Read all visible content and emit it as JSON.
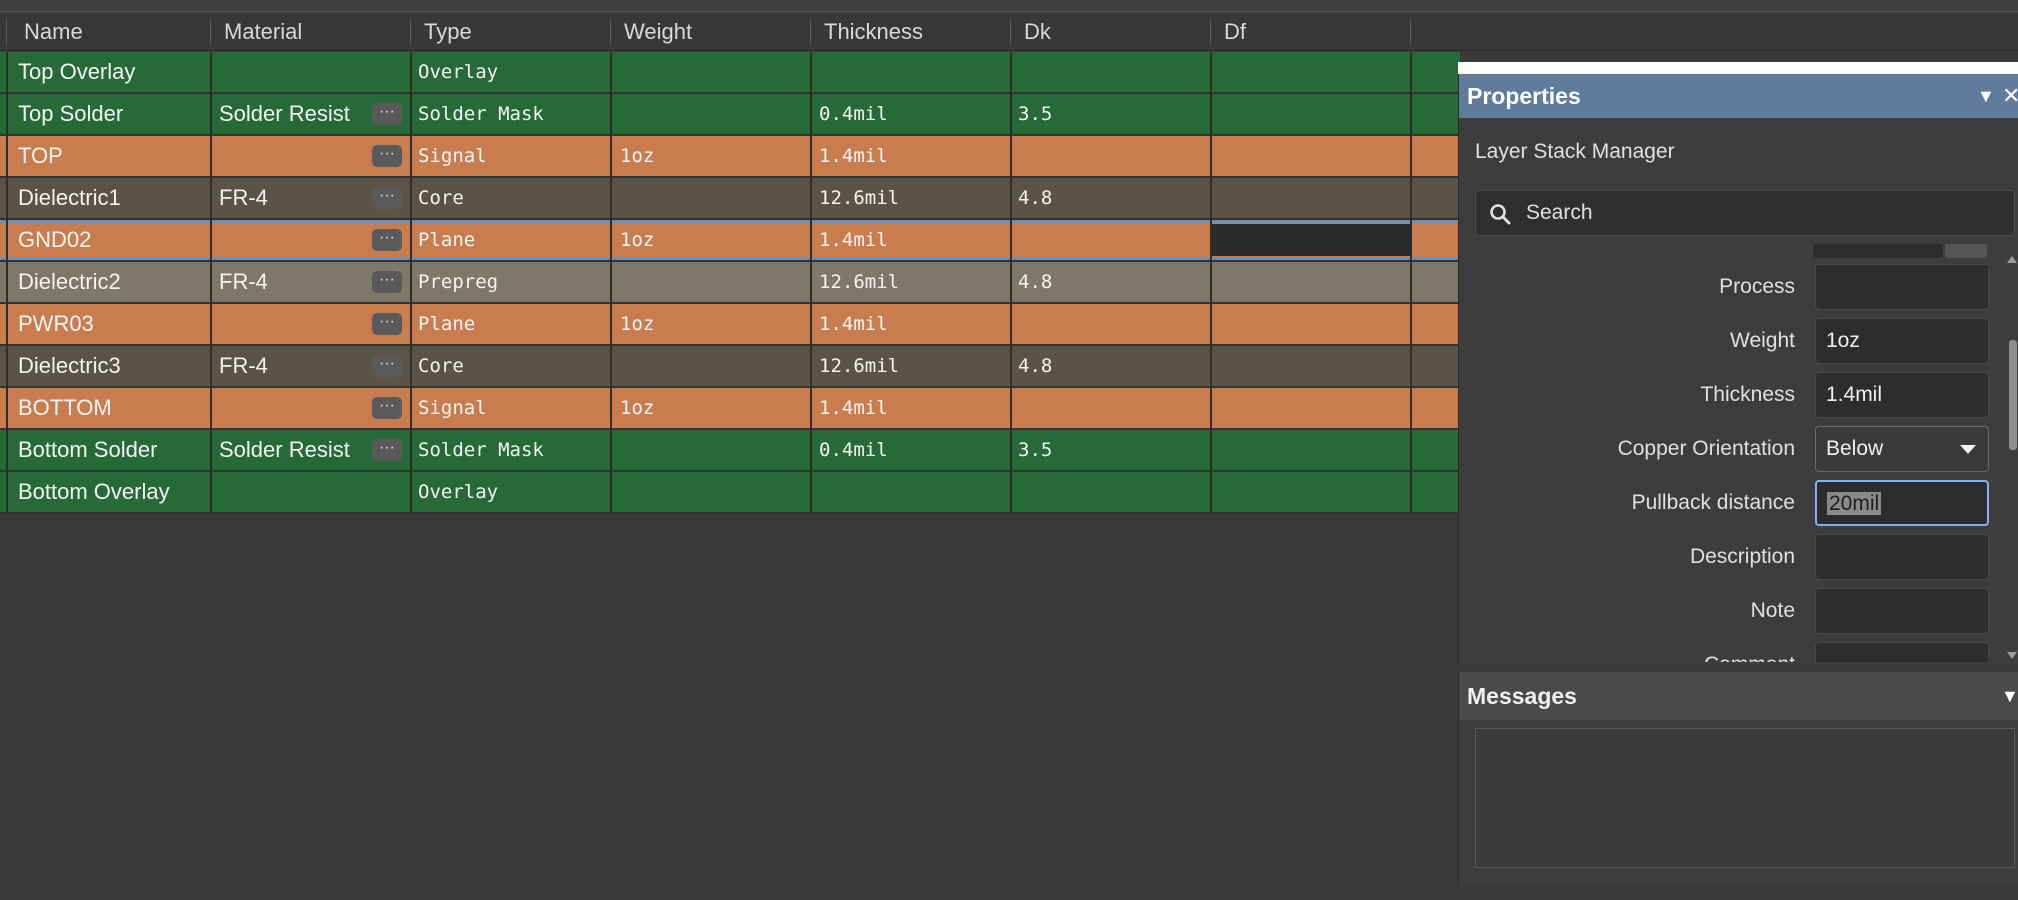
{
  "columns": [
    "Name",
    "Material",
    "Type",
    "Weight",
    "Thickness",
    "Dk",
    "Df"
  ],
  "layers": [
    {
      "name": "Top Overlay",
      "material": "",
      "type": "Overlay",
      "weight": "",
      "thickness": "",
      "dk": "",
      "df": "",
      "style": "overlay",
      "has_material_button": false
    },
    {
      "name": "Top Solder",
      "material": "Solder Resist",
      "type": "Solder Mask",
      "weight": "",
      "thickness": "0.4mil",
      "dk": "3.5",
      "df": "",
      "style": "solder",
      "has_material_button": true
    },
    {
      "name": "TOP",
      "material": "",
      "type": "Signal",
      "weight": "1oz",
      "thickness": "1.4mil",
      "dk": "",
      "df": "",
      "style": "signal",
      "has_material_button": true
    },
    {
      "name": "Dielectric1",
      "material": "FR-4",
      "type": "Core",
      "weight": "",
      "thickness": "12.6mil",
      "dk": "4.8",
      "df": "",
      "style": "core",
      "has_material_button": true
    },
    {
      "name": "GND02",
      "material": "",
      "type": "Plane",
      "weight": "1oz",
      "thickness": "1.4mil",
      "dk": "",
      "df": "",
      "style": "signal",
      "has_material_button": true,
      "selected": true
    },
    {
      "name": "Dielectric2",
      "material": "FR-4",
      "type": "Prepreg",
      "weight": "",
      "thickness": "12.6mil",
      "dk": "4.8",
      "df": "",
      "style": "prepreg",
      "has_material_button": true
    },
    {
      "name": "PWR03",
      "material": "",
      "type": "Plane",
      "weight": "1oz",
      "thickness": "1.4mil",
      "dk": "",
      "df": "",
      "style": "signal",
      "has_material_button": true
    },
    {
      "name": "Dielectric3",
      "material": "FR-4",
      "type": "Core",
      "weight": "",
      "thickness": "12.6mil",
      "dk": "4.8",
      "df": "",
      "style": "core",
      "has_material_button": true
    },
    {
      "name": "BOTTOM",
      "material": "",
      "type": "Signal",
      "weight": "1oz",
      "thickness": "1.4mil",
      "dk": "",
      "df": "",
      "style": "signal",
      "has_material_button": true
    },
    {
      "name": "Bottom Solder",
      "material": "Solder Resist",
      "type": "Solder Mask",
      "weight": "",
      "thickness": "0.4mil",
      "dk": "3.5",
      "df": "",
      "style": "solder",
      "has_material_button": true
    },
    {
      "name": "Bottom Overlay",
      "material": "",
      "type": "Overlay",
      "weight": "",
      "thickness": "",
      "dk": "",
      "df": "",
      "style": "overlay",
      "has_material_button": false
    }
  ],
  "material_button_label": "···",
  "properties": {
    "title": "Properties",
    "subtitle": "Layer Stack Manager",
    "search_placeholder": "Search",
    "fields": [
      {
        "label": "Process",
        "value": "",
        "kind": "text"
      },
      {
        "label": "Weight",
        "value": "1oz",
        "kind": "text"
      },
      {
        "label": "Thickness",
        "value": "1.4mil",
        "kind": "text"
      },
      {
        "label": "Copper Orientation",
        "value": "Below",
        "kind": "dropdown"
      },
      {
        "label": "Pullback distance",
        "value": "20mil",
        "kind": "focused"
      },
      {
        "label": "Description",
        "value": "",
        "kind": "text"
      },
      {
        "label": "Note",
        "value": "",
        "kind": "text"
      },
      {
        "label": "Comment",
        "value": "",
        "kind": "text"
      }
    ]
  },
  "messages": {
    "title": "Messages"
  },
  "colors": {
    "overlay": "#256a37",
    "signal": "#c97d4f",
    "core": "#5b5446",
    "prepreg": "#7e7868",
    "properties_header": "#5f7c9d",
    "focus_border": "#7fb3ee"
  }
}
